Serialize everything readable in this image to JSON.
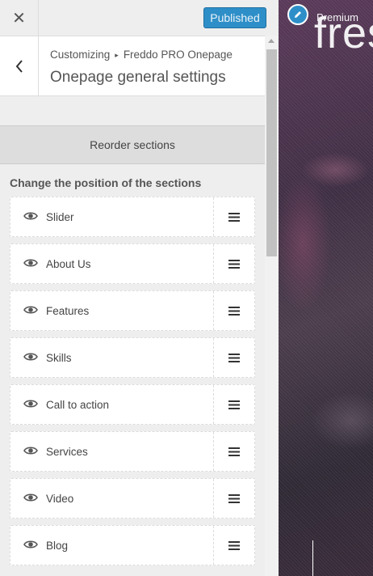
{
  "topbar": {
    "close_label": "✕",
    "publish_label": "Published"
  },
  "header": {
    "breadcrumb_root": "Customizing",
    "breadcrumb_sep": "▸",
    "breadcrumb_page": "Freddo PRO Onepage",
    "title": "Onepage general settings"
  },
  "reorder": {
    "label": "Reorder sections"
  },
  "description": "Change the position of the sections",
  "sections": [
    {
      "label": "Slider",
      "visible_icon": "eye-icon",
      "handle_icon": "drag-handle-icon"
    },
    {
      "label": "About Us",
      "visible_icon": "eye-icon",
      "handle_icon": "drag-handle-icon"
    },
    {
      "label": "Features",
      "visible_icon": "eye-icon",
      "handle_icon": "drag-handle-icon"
    },
    {
      "label": "Skills",
      "visible_icon": "eye-icon",
      "handle_icon": "drag-handle-icon"
    },
    {
      "label": "Call to action",
      "visible_icon": "eye-icon",
      "handle_icon": "drag-handle-icon"
    },
    {
      "label": "Services",
      "visible_icon": "eye-icon",
      "handle_icon": "drag-handle-icon"
    },
    {
      "label": "Video",
      "visible_icon": "eye-icon",
      "handle_icon": "drag-handle-icon"
    },
    {
      "label": "Blog",
      "visible_icon": "eye-icon",
      "handle_icon": "drag-handle-icon"
    }
  ],
  "preview": {
    "premium_text": "Premium",
    "brand_text": "fres"
  },
  "colors": {
    "accent": "#2e8fc8",
    "sidebar_bg": "#eeeeee",
    "reorder_bg": "#dddddd"
  }
}
